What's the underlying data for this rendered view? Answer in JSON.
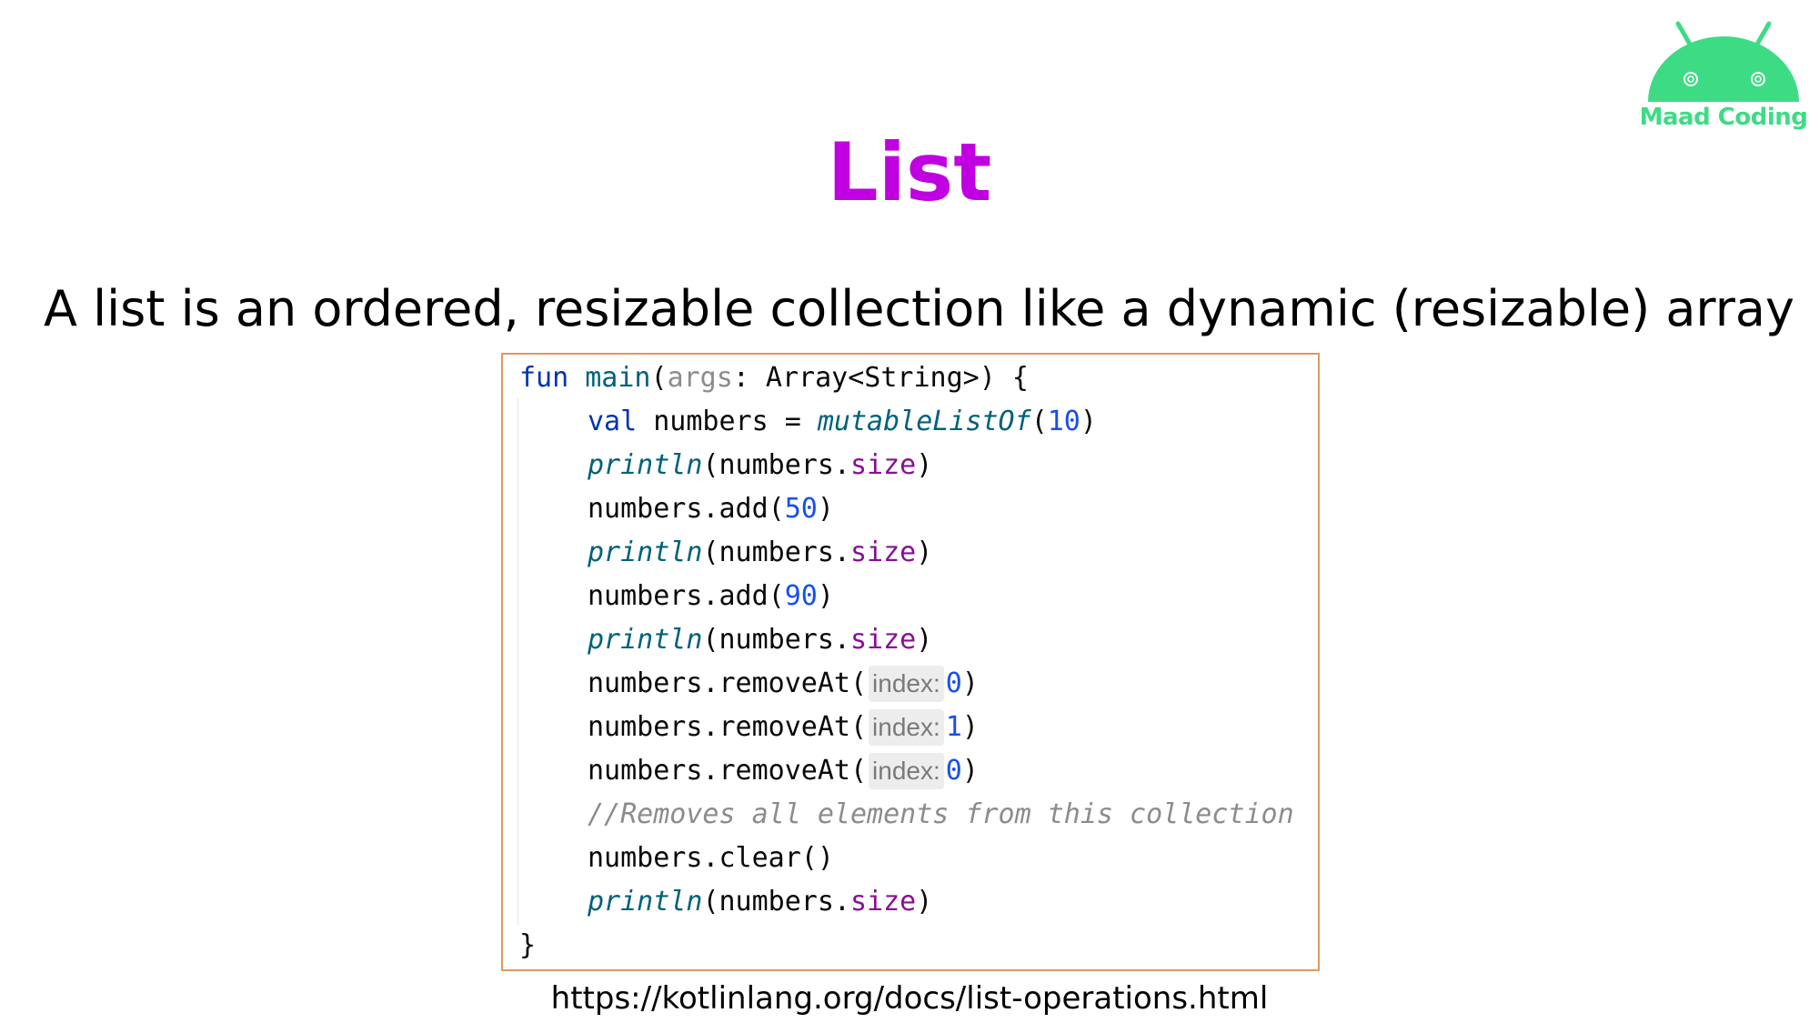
{
  "logo": {
    "text": "Maad Coding",
    "icon": "android-robot-head-icon",
    "color": "#3ddc84"
  },
  "title": "List",
  "description": "A list is an ordered, resizable collection like a dynamic (resizable) array",
  "code": {
    "l1": {
      "kw": "fun",
      "name": "main",
      "open": "(",
      "param": "args",
      "rest": ": Array<String>) {"
    },
    "l2": {
      "kw": "val",
      "mid": " numbers = ",
      "call": "mutableListOf",
      "open": "(",
      "num": "10",
      "close": ")"
    },
    "l3": {
      "call": "println",
      "open": "(numbers.",
      "prop": "size",
      "close": ")"
    },
    "l4": {
      "text": "numbers.add(",
      "num": "50",
      "close": ")"
    },
    "l5": {
      "call": "println",
      "open": "(numbers.",
      "prop": "size",
      "close": ")"
    },
    "l6": {
      "text": "numbers.add(",
      "num": "90",
      "close": ")"
    },
    "l7": {
      "call": "println",
      "open": "(numbers.",
      "prop": "size",
      "close": ")"
    },
    "l8": {
      "text": "numbers.removeAt(",
      "hint": "index:",
      "num": "0",
      "close": ")"
    },
    "l9": {
      "text": "numbers.removeAt(",
      "hint": "index:",
      "num": "1",
      "close": ")"
    },
    "l10": {
      "text": "numbers.removeAt(",
      "hint": "index:",
      "num": "0",
      "close": ")"
    },
    "l11": {
      "comment": "//Removes all elements from this collection"
    },
    "l12": {
      "text": "numbers.clear()"
    },
    "l13": {
      "call": "println",
      "open": "(numbers.",
      "prop": "size",
      "close": ")"
    },
    "l14": {
      "text": "}"
    }
  },
  "link": "https://kotlinlang.org/docs/list-operations.html"
}
